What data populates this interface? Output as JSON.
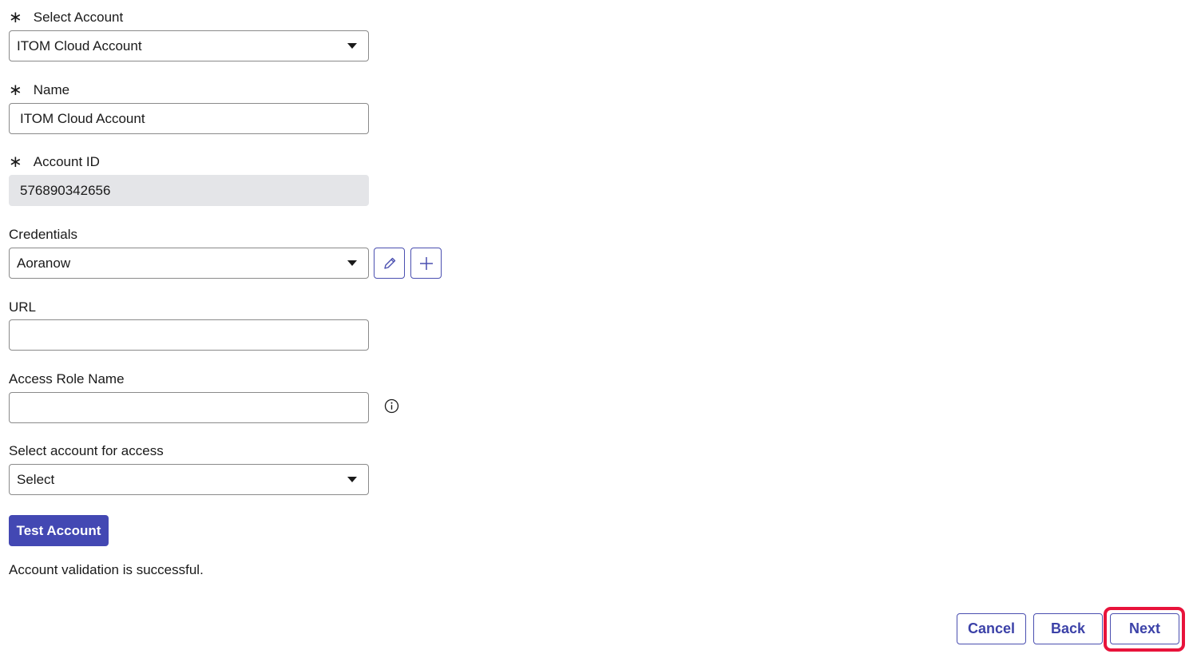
{
  "form": {
    "select_account": {
      "label": "Select Account",
      "required_mark": "∗",
      "value": "ITOM Cloud Account"
    },
    "name": {
      "label": "Name",
      "required_mark": "∗",
      "value": "ITOM Cloud Account"
    },
    "account_id": {
      "label": "Account ID",
      "required_mark": "∗",
      "value": "576890342656"
    },
    "credentials": {
      "label": "Credentials",
      "value": "Aoranow"
    },
    "url": {
      "label": "URL",
      "value": ""
    },
    "access_role_name": {
      "label": "Access Role Name",
      "value": ""
    },
    "account_for_access": {
      "label": "Select account for access",
      "value": "Select"
    }
  },
  "test_button": "Test Account",
  "status_message": "Account validation is successful.",
  "footer": {
    "cancel": "Cancel",
    "back": "Back",
    "next": "Next"
  },
  "colors": {
    "accent": "#4348b3",
    "highlight": "#e8133b",
    "readonly_bg": "#e4e5e8"
  },
  "icons": [
    "edit-pencil-icon",
    "add-plus-icon",
    "info-icon",
    "dropdown-caret-icon",
    "required-asterisk-icon"
  ]
}
